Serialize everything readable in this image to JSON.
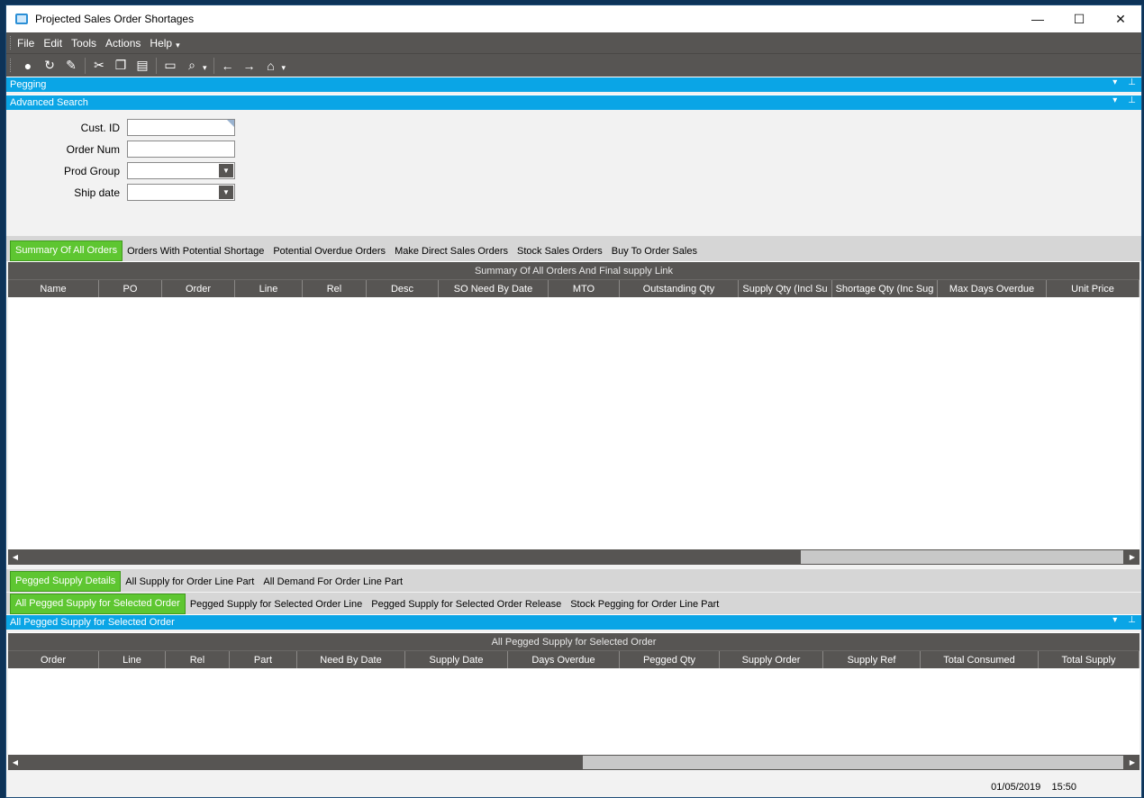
{
  "window": {
    "title": "Projected Sales Order Shortages"
  },
  "titlebar_buttons": [
    "—",
    "☐",
    "✕"
  ],
  "menu": [
    "File",
    "Edit",
    "Tools",
    "Actions",
    "Help"
  ],
  "panels": {
    "pegging": "Pegging",
    "advanced_search": "Advanced Search",
    "pegged_panel": "All Pegged Supply for Selected Order"
  },
  "search": {
    "cust_id_label": "Cust. ID",
    "order_num_label": "Order Num",
    "prod_group_label": "Prod Group",
    "ship_date_label": "Ship date",
    "cust_id_value": "",
    "order_num_value": "",
    "prod_group_value": "",
    "ship_date_value": ""
  },
  "top_tabs": [
    "Summary Of All Orders",
    "Orders With Potential Shortage",
    "Potential Overdue Orders",
    "Make Direct Sales Orders",
    "Stock Sales Orders",
    "Buy To Order Sales"
  ],
  "top_grid": {
    "title": "Summary Of All Orders And Final supply Link",
    "columns": [
      "Name",
      "PO",
      "Order",
      "Line",
      "Rel",
      "Desc",
      "SO Need By Date",
      "MTO",
      "Outstanding Qty",
      "Supply Qty (Incl Su",
      "Shortage Qty (Inc Sug",
      "Max Days Overdue",
      "Unit Price"
    ]
  },
  "bottom_tabs": [
    "Pegged Supply Details",
    "All Supply for Order Line Part",
    "All Demand For Order Line Part"
  ],
  "sub_tabs": [
    "All Pegged Supply for Selected Order",
    "Pegged Supply for Selected Order Line",
    "Pegged Supply for Selected Order Release",
    "Stock Pegging for Order Line Part"
  ],
  "bottom_grid": {
    "title": "All Pegged Supply for Selected Order",
    "columns": [
      "Order",
      "Line",
      "Rel",
      "Part",
      "Need By Date",
      "Supply Date",
      "Days Overdue",
      "Pegged Qty",
      "Supply Order",
      "Supply Ref",
      "Total Consumed",
      "Total Supply"
    ]
  },
  "status": {
    "date": "01/05/2019",
    "time": "15:50"
  },
  "colors": {
    "accent": "#0aa5e6",
    "active_tab": "#5ec631",
    "toolbar": "#575553"
  }
}
